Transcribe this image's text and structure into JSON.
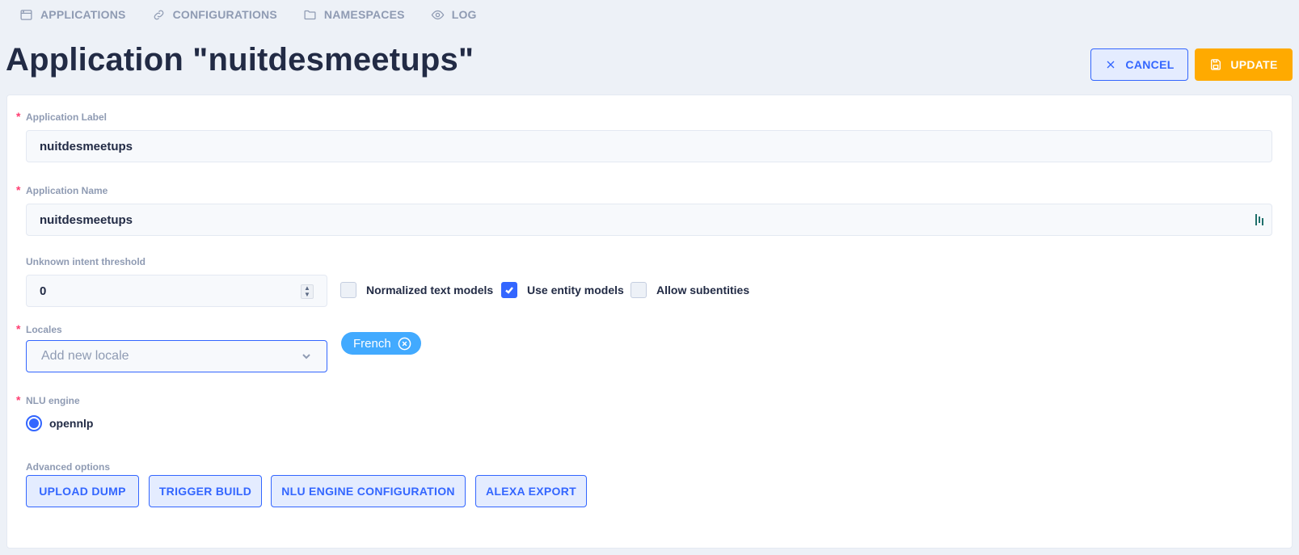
{
  "nav": {
    "applications": "APPLICATIONS",
    "configurations": "CONFIGURATIONS",
    "namespaces": "NAMESPACES",
    "log": "LOG"
  },
  "header": {
    "title": "Application \"nuitdesmeetups\"",
    "cancel_label": "CANCEL",
    "update_label": "UPDATE"
  },
  "form": {
    "required_mark": "*",
    "app_label": {
      "label": "Application Label",
      "value": "nuitdesmeetups"
    },
    "app_name": {
      "label": "Application Name",
      "value": "nuitdesmeetups"
    },
    "threshold": {
      "label": "Unknown intent threshold",
      "value": "0"
    },
    "checkboxes": [
      {
        "label": "Normalized text models",
        "checked": false
      },
      {
        "label": "Use entity models",
        "checked": true
      },
      {
        "label": "Allow subentities",
        "checked": false
      }
    ],
    "locales": {
      "label": "Locales",
      "placeholder": "Add new locale",
      "tags": [
        "French"
      ]
    },
    "nlu_engine": {
      "label": "NLU engine",
      "options": [
        "opennlp"
      ],
      "selected": "opennlp"
    },
    "advanced": {
      "label": "Advanced options",
      "buttons": [
        "UPLOAD DUMP",
        "TRIGGER BUILD",
        "NLU ENGINE CONFIGURATION",
        "ALEXA EXPORT"
      ]
    }
  },
  "colors": {
    "primary": "#3366ff",
    "warning": "#ffaa00",
    "info": "#42aaff",
    "danger": "#ff3d71",
    "background": "#edf1f7"
  }
}
